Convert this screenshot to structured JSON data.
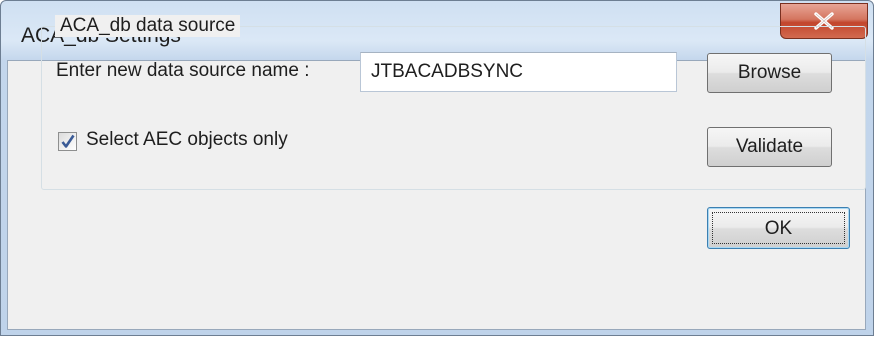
{
  "window": {
    "title": "ACA_db Settings"
  },
  "group": {
    "legend": "ACA_db data source"
  },
  "data_source": {
    "label": "Enter new data source name :",
    "value": "JTBACADBSYNC"
  },
  "checkbox": {
    "label": "Select AEC objects only",
    "checked": true
  },
  "buttons": {
    "browse": "Browse",
    "validate": "Validate",
    "ok": "OK"
  },
  "icons": {
    "close": "close-icon",
    "check": "checkmark-icon"
  },
  "colors": {
    "close_button": "#c7472c",
    "checkmark": "#3a5a96",
    "ok_border": "#3c7fb1"
  }
}
